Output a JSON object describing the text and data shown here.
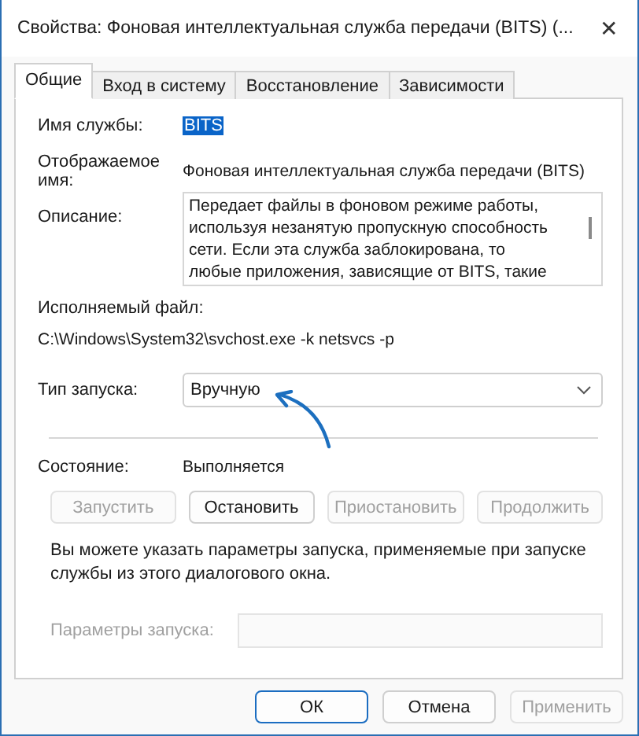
{
  "window": {
    "title": "Свойства: Фоновая интеллектуальная служба передачи (BITS) (...",
    "close": "✕"
  },
  "tabs": [
    {
      "label": "Общие",
      "selected": true
    },
    {
      "label": "Вход в систему",
      "selected": false
    },
    {
      "label": "Восстановление",
      "selected": false
    },
    {
      "label": "Зависимости",
      "selected": false
    }
  ],
  "general": {
    "service_name": {
      "label": "Имя службы:",
      "value": "BITS",
      "highlighted": true
    },
    "display_name": {
      "label_lines": [
        "Отображаемое",
        "имя:"
      ],
      "value": "Фоновая интеллектуальная служба передачи (BITS)"
    },
    "description": {
      "label": "Описание:",
      "lines": [
        "Передает файлы в фоновом режиме работы,",
        "используя незанятую пропускную способность",
        "сети. Если эта служба заблокирована, то",
        "любые приложения, зависящие от BITS, такие"
      ]
    },
    "executable": {
      "label": "Исполняемый файл:",
      "value": "C:\\Windows\\System32\\svchost.exe -k netsvcs -p"
    },
    "startup_type": {
      "label": "Тип запуска:",
      "value": "Вручную"
    },
    "status": {
      "label": "Состояние:",
      "value": "Выполняется"
    },
    "service_buttons": [
      {
        "label": "Запустить",
        "disabled": true
      },
      {
        "label": "Остановить",
        "disabled": false
      },
      {
        "label": "Приостановить",
        "disabled": true
      },
      {
        "label": "Продолжить",
        "disabled": true
      }
    ],
    "hint": "Вы можете указать параметры запуска, применяемые при запуске службы из этого диалогового окна.",
    "start_parameters": {
      "label": "Параметры запуска:",
      "disabled": true
    }
  },
  "buttons": [
    {
      "label": "ОК",
      "default": true,
      "disabled": false
    },
    {
      "label": "Отмена",
      "default": false,
      "disabled": false
    },
    {
      "label": "Применить",
      "default": false,
      "disabled": true
    }
  ]
}
